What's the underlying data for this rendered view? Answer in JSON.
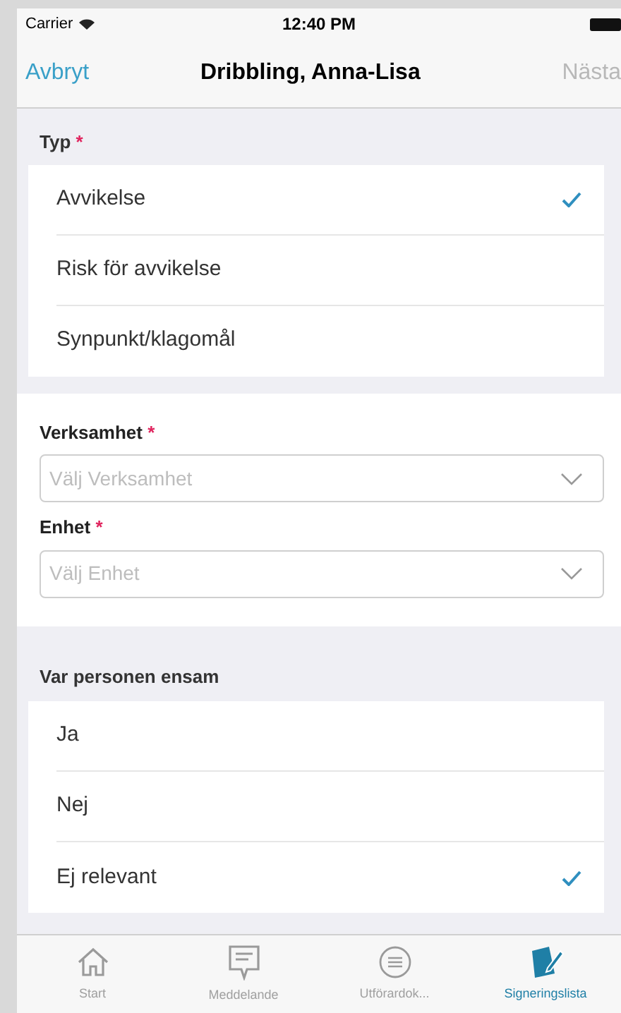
{
  "status_bar": {
    "carrier": "Carrier",
    "time": "12:40 PM"
  },
  "nav": {
    "cancel": "Avbryt",
    "title": "Dribbling, Anna-Lisa",
    "next": "Nästa"
  },
  "type_group": {
    "label": "Typ",
    "required_mark": "*",
    "options": [
      {
        "label": "Avvikelse",
        "selected": true
      },
      {
        "label": "Risk för avvikelse",
        "selected": false
      },
      {
        "label": "Synpunkt/klagomål",
        "selected": false
      }
    ]
  },
  "selects": [
    {
      "label": "Verksamhet",
      "required_mark": "*",
      "placeholder": "Välj Verksamhet"
    },
    {
      "label": "Enhet",
      "required_mark": "*",
      "placeholder": "Välj Enhet"
    }
  ],
  "alone_group": {
    "label": "Var personen ensam",
    "options": [
      {
        "label": "Ja",
        "selected": false
      },
      {
        "label": "Nej",
        "selected": false
      },
      {
        "label": "Ej relevant",
        "selected": true
      }
    ]
  },
  "tab_bar": [
    {
      "kind": "home",
      "label": "Start",
      "selected": false
    },
    {
      "kind": "message",
      "label": "Meddelande",
      "selected": false
    },
    {
      "kind": "doc",
      "label": "Utförardok...",
      "selected": false
    },
    {
      "kind": "sign",
      "label": "Signeringslista",
      "selected": true
    }
  ]
}
